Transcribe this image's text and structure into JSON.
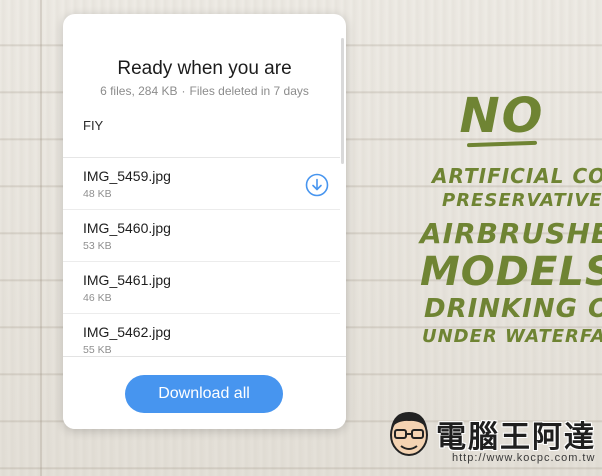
{
  "dialog": {
    "title": "Ready when you are",
    "summary": {
      "file_count": "6 files, 284 KB",
      "separator": "·",
      "expiry": "Files deleted in 7 days"
    },
    "message": "FIY"
  },
  "files": [
    {
      "name": "IMG_5459.jpg",
      "size": "48 KB",
      "download_icon": "download-circle-icon"
    },
    {
      "name": "IMG_5460.jpg",
      "size": "53 KB"
    },
    {
      "name": "IMG_5461.jpg",
      "size": "46 KB"
    },
    {
      "name": "IMG_5462.jpg",
      "size": "55 KB"
    }
  ],
  "footer": {
    "download_all_label": "Download all"
  },
  "background": {
    "slogan": [
      "NO",
      "ARTIFICIAL COLOU",
      "PRESERVATIVES OR",
      "AIRBRUSHED",
      "MODELS",
      "DRINKING OVE",
      "UNDER WATERFALL"
    ]
  },
  "watermark": {
    "title": "電腦王阿達",
    "url": "http://www.kocpc.com.tw"
  },
  "colors": {
    "accent": "#4795ef",
    "slogan_green": "#6f8433"
  }
}
